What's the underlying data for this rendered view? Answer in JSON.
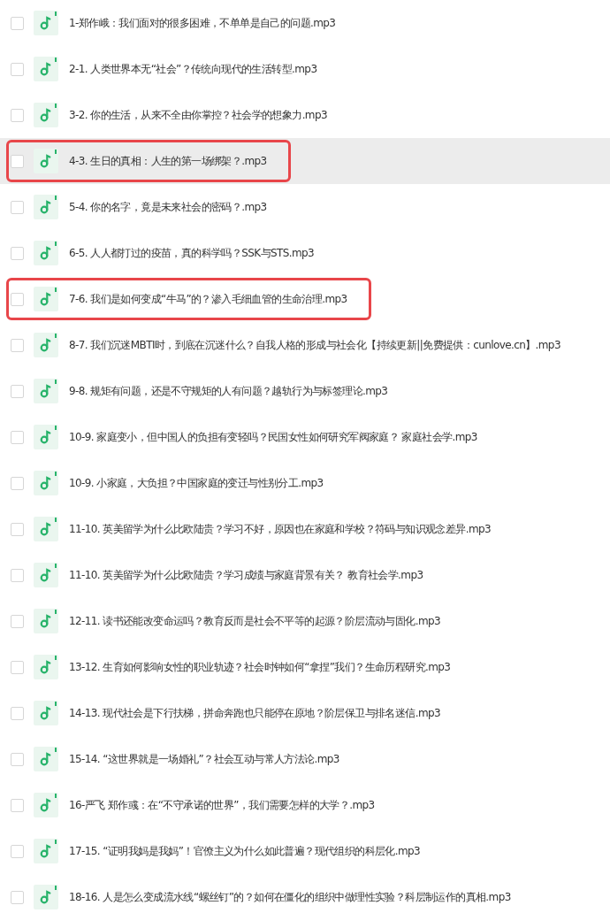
{
  "files": [
    {
      "name": "1-郑作峨：我们面对的很多困难，不单单是自己的问题.mp3",
      "checked": false,
      "hovered": false,
      "annotated": false
    },
    {
      "name": "2-1. 人类世界本无“社会”？传统向现代的生活转型.mp3",
      "checked": false,
      "hovered": false,
      "annotated": false
    },
    {
      "name": "3-2. 你的生活，从来不全由你掌控？社会学的想象力.mp3",
      "checked": false,
      "hovered": false,
      "annotated": false
    },
    {
      "name": "4-3. 生日的真相：人生的第一场绑架？.mp3",
      "checked": false,
      "hovered": true,
      "annotated": true
    },
    {
      "name": "5-4. 你的名字，竟是未来社会的密码？.mp3",
      "checked": false,
      "hovered": false,
      "annotated": false
    },
    {
      "name": "6-5. 人人都打过的疫苗，真的科学吗？SSK与STS.mp3",
      "checked": false,
      "hovered": false,
      "annotated": false
    },
    {
      "name": "7-6. 我们是如何变成“牛马”的？渗入毛细血管的生命治理.mp3",
      "checked": false,
      "hovered": false,
      "annotated": true
    },
    {
      "name": "8-7. 我们沉迷MBTI时，到底在沉迷什么？自我人格的形成与社会化【持续更新||免费提供：cunlove.cn】.mp3",
      "checked": false,
      "hovered": false,
      "annotated": false
    },
    {
      "name": "9-8. 规矩有问题，还是不守规矩的人有问题？越轨行为与标签理论.mp3",
      "checked": false,
      "hovered": false,
      "annotated": false
    },
    {
      "name": "10-9. 家庭变小，但中国人的负担有变轻吗？民国女性如何研究军阀家庭？ 家庭社会学.mp3",
      "checked": false,
      "hovered": false,
      "annotated": false
    },
    {
      "name": "10-9. 小家庭，大负担？中国家庭的变迁与性别分工.mp3",
      "checked": false,
      "hovered": false,
      "annotated": false
    },
    {
      "name": "11-10. 英美留学为什么比欧陆贵？学习不好，原因也在家庭和学校？符码与知识观念差异.mp3",
      "checked": false,
      "hovered": false,
      "annotated": false
    },
    {
      "name": "11-10. 英美留学为什么比欧陆贵？学习成绩与家庭背景有关？ 教育社会学.mp3",
      "checked": false,
      "hovered": false,
      "annotated": false
    },
    {
      "name": "12-11. 读书还能改变命运吗？教育反而是社会不平等的起源？阶层流动与固化.mp3",
      "checked": false,
      "hovered": false,
      "annotated": false
    },
    {
      "name": "13-12. 生育如何影响女性的职业轨迹？社会时钟如何“拿捏”我们？生命历程研究.mp3",
      "checked": false,
      "hovered": false,
      "annotated": false
    },
    {
      "name": "14-13. 现代社会是下行扶梯，拼命奔跑也只能停在原地？阶层保卫与排名迷信.mp3",
      "checked": false,
      "hovered": false,
      "annotated": false
    },
    {
      "name": "15-14. “这世界就是一场婚礼”？社会互动与常人方法论.mp3",
      "checked": false,
      "hovered": false,
      "annotated": false
    },
    {
      "name": "16-严飞 郑作彧：在“不守承诺的世界”，我们需要怎样的大学？.mp3",
      "checked": false,
      "hovered": false,
      "annotated": false
    },
    {
      "name": "17-15. “证明我妈是我妈”！官僚主义为什么如此普遍？现代组织的科层化.mp3",
      "checked": false,
      "hovered": false,
      "annotated": false
    },
    {
      "name": "18-16. 人是怎么变成流水线“螺丝钉”的？如何在僵化的组织中做理性实验？科层制运作的真相.mp3",
      "checked": false,
      "hovered": false,
      "annotated": false
    }
  ]
}
